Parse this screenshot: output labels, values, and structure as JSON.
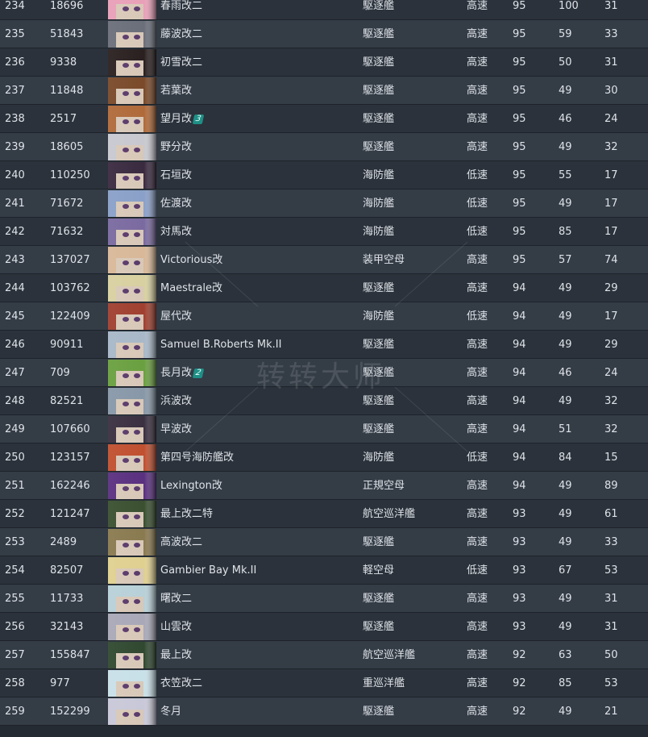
{
  "watermark": "转转大师",
  "avatar_colors": {
    "0": "#e8a0b8",
    "1": "#6b6f7a",
    "2": "#2a2020",
    "3": "#7a4a2a",
    "4": "#b06a3a",
    "5": "#c8c8d0",
    "6": "#3a2a40",
    "7": "#8aa0c8",
    "8": "#7a6aa0",
    "9": "#d8b898",
    "10": "#d8d0a0",
    "11": "#a04030",
    "12": "#a8b8c8",
    "13": "#6aa040",
    "14": "#8898a8",
    "15": "#3a3040",
    "16": "#c05030",
    "17": "#5a3080",
    "18": "#3a5030",
    "19": "#8a7a50",
    "20": "#e0d090",
    "21": "#b8d0d8",
    "22": "#a8a8b8",
    "23": "#304830",
    "24": "#c8e0e8",
    "25": "#c8c8d8"
  },
  "rows": [
    {
      "rank": "234",
      "id": "18696",
      "name": "春雨改二",
      "badge": "",
      "type": "駆逐艦",
      "speed": "高速",
      "a": "95",
      "b": "100",
      "c": "31"
    },
    {
      "rank": "235",
      "id": "51843",
      "name": "藤波改二",
      "badge": "",
      "type": "駆逐艦",
      "speed": "高速",
      "a": "95",
      "b": "59",
      "c": "33"
    },
    {
      "rank": "236",
      "id": "9338",
      "name": "初雪改二",
      "badge": "",
      "type": "駆逐艦",
      "speed": "高速",
      "a": "95",
      "b": "50",
      "c": "31"
    },
    {
      "rank": "237",
      "id": "11848",
      "name": "若葉改",
      "badge": "",
      "type": "駆逐艦",
      "speed": "高速",
      "a": "95",
      "b": "49",
      "c": "30"
    },
    {
      "rank": "238",
      "id": "2517",
      "name": "望月改",
      "badge": "3",
      "type": "駆逐艦",
      "speed": "高速",
      "a": "95",
      "b": "46",
      "c": "24"
    },
    {
      "rank": "239",
      "id": "18605",
      "name": "野分改",
      "badge": "",
      "type": "駆逐艦",
      "speed": "高速",
      "a": "95",
      "b": "49",
      "c": "32"
    },
    {
      "rank": "240",
      "id": "110250",
      "name": "石垣改",
      "badge": "",
      "type": "海防艦",
      "speed": "低速",
      "a": "95",
      "b": "55",
      "c": "17"
    },
    {
      "rank": "241",
      "id": "71672",
      "name": "佐渡改",
      "badge": "",
      "type": "海防艦",
      "speed": "低速",
      "a": "95",
      "b": "49",
      "c": "17"
    },
    {
      "rank": "242",
      "id": "71632",
      "name": "対馬改",
      "badge": "",
      "type": "海防艦",
      "speed": "低速",
      "a": "95",
      "b": "85",
      "c": "17"
    },
    {
      "rank": "243",
      "id": "137027",
      "name": "Victorious改",
      "badge": "",
      "type": "装甲空母",
      "speed": "高速",
      "a": "95",
      "b": "57",
      "c": "74"
    },
    {
      "rank": "244",
      "id": "103762",
      "name": "Maestrale改",
      "badge": "",
      "type": "駆逐艦",
      "speed": "高速",
      "a": "94",
      "b": "49",
      "c": "29"
    },
    {
      "rank": "245",
      "id": "122409",
      "name": "屋代改",
      "badge": "",
      "type": "海防艦",
      "speed": "低速",
      "a": "94",
      "b": "49",
      "c": "17"
    },
    {
      "rank": "246",
      "id": "90911",
      "name": "Samuel B.Roberts Mk.II",
      "badge": "",
      "type": "駆逐艦",
      "speed": "高速",
      "a": "94",
      "b": "49",
      "c": "29"
    },
    {
      "rank": "247",
      "id": "709",
      "name": "長月改",
      "badge": "2",
      "type": "駆逐艦",
      "speed": "高速",
      "a": "94",
      "b": "46",
      "c": "24"
    },
    {
      "rank": "248",
      "id": "82521",
      "name": "浜波改",
      "badge": "",
      "type": "駆逐艦",
      "speed": "高速",
      "a": "94",
      "b": "49",
      "c": "32"
    },
    {
      "rank": "249",
      "id": "107660",
      "name": "早波改",
      "badge": "",
      "type": "駆逐艦",
      "speed": "高速",
      "a": "94",
      "b": "51",
      "c": "32"
    },
    {
      "rank": "250",
      "id": "123157",
      "name": "第四号海防艦改",
      "badge": "",
      "type": "海防艦",
      "speed": "低速",
      "a": "94",
      "b": "84",
      "c": "15"
    },
    {
      "rank": "251",
      "id": "162246",
      "name": "Lexington改",
      "badge": "",
      "type": "正規空母",
      "speed": "高速",
      "a": "94",
      "b": "49",
      "c": "89"
    },
    {
      "rank": "252",
      "id": "121247",
      "name": "最上改二特",
      "badge": "",
      "type": "航空巡洋艦",
      "speed": "高速",
      "a": "93",
      "b": "49",
      "c": "61"
    },
    {
      "rank": "253",
      "id": "2489",
      "name": "高波改二",
      "badge": "",
      "type": "駆逐艦",
      "speed": "高速",
      "a": "93",
      "b": "49",
      "c": "33"
    },
    {
      "rank": "254",
      "id": "82507",
      "name": "Gambier Bay Mk.II",
      "badge": "",
      "type": "軽空母",
      "speed": "低速",
      "a": "93",
      "b": "67",
      "c": "53"
    },
    {
      "rank": "255",
      "id": "11733",
      "name": "曙改二",
      "badge": "",
      "type": "駆逐艦",
      "speed": "高速",
      "a": "93",
      "b": "49",
      "c": "31"
    },
    {
      "rank": "256",
      "id": "32143",
      "name": "山雲改",
      "badge": "",
      "type": "駆逐艦",
      "speed": "高速",
      "a": "93",
      "b": "49",
      "c": "31"
    },
    {
      "rank": "257",
      "id": "155847",
      "name": "最上改",
      "badge": "",
      "type": "航空巡洋艦",
      "speed": "高速",
      "a": "92",
      "b": "63",
      "c": "50"
    },
    {
      "rank": "258",
      "id": "977",
      "name": "衣笠改二",
      "badge": "",
      "type": "重巡洋艦",
      "speed": "高速",
      "a": "92",
      "b": "85",
      "c": "53"
    },
    {
      "rank": "259",
      "id": "152299",
      "name": "冬月",
      "badge": "",
      "type": "駆逐艦",
      "speed": "高速",
      "a": "92",
      "b": "49",
      "c": "21"
    }
  ]
}
